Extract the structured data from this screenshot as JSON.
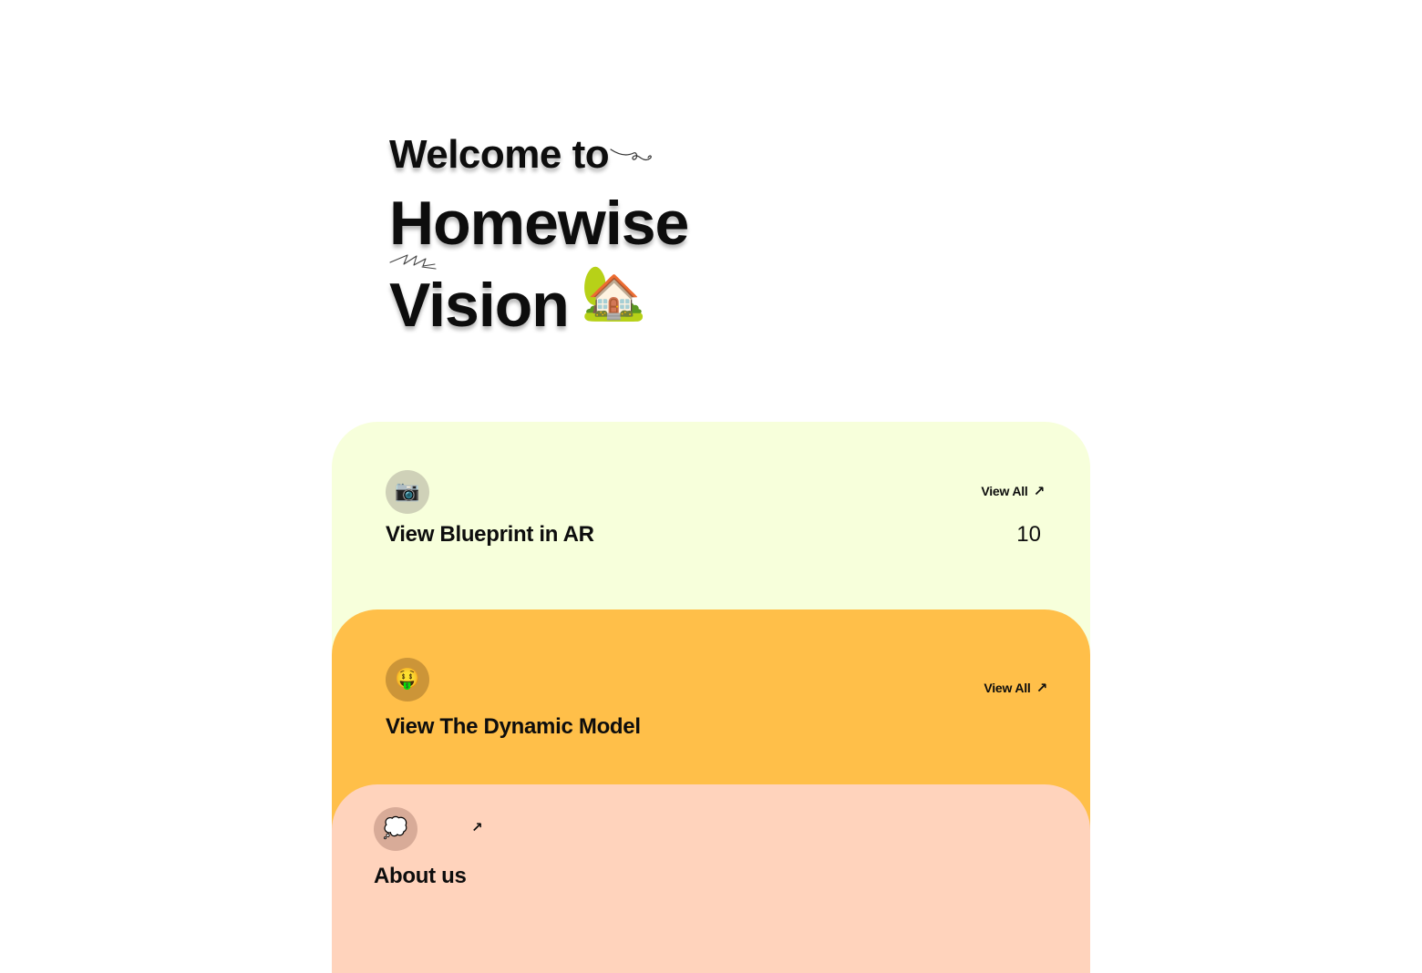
{
  "hero": {
    "welcome": "Welcome to",
    "title_line1": "Homewise",
    "title_line2": "Vision",
    "title_emoji": "🏡"
  },
  "cards": [
    {
      "icon": "📷",
      "icon_name": "camera-icon",
      "title": "View Blueprint in AR",
      "link_label": "View All",
      "link_arrow": "↗",
      "count": "10",
      "background": "#f7ffdb"
    },
    {
      "icon": "🤑",
      "icon_name": "money-face-icon",
      "title": "View The Dynamic Model",
      "link_label": "View All",
      "link_arrow": "↗",
      "background": "#ffbf49"
    },
    {
      "icon": "💭",
      "icon_name": "thought-bubble-icon",
      "title": "About us",
      "link_arrow": "↗",
      "background": "#ffd3bc"
    }
  ]
}
